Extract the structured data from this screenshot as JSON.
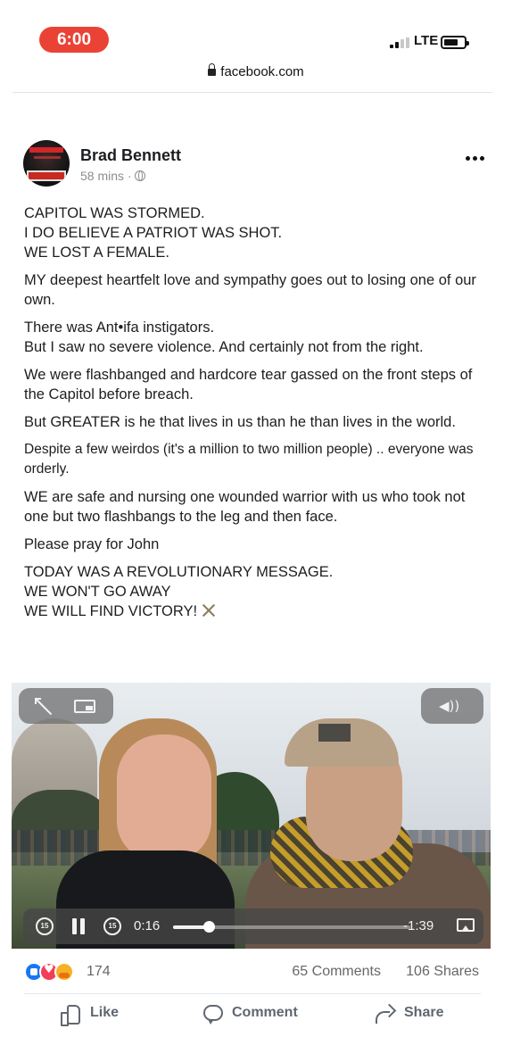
{
  "status_bar": {
    "time": "6:00",
    "network": "LTE",
    "signal_bars": 2,
    "battery_level": 0.55,
    "colors": {
      "time_pill": "#ea4335"
    }
  },
  "browser": {
    "url": "facebook.com",
    "icon": "lock-icon"
  },
  "post": {
    "author": "Brad Bennett",
    "time": "58 mins",
    "separator": " · ",
    "audience_icon": "globe-icon",
    "menu_icon": "more-icon",
    "paragraphs": [
      "CAPITOL WAS STORMED.\nI DO BELIEVE A PATRIOT WAS SHOT.\nWE LOST A FEMALE.",
      "MY deepest heartfelt love and sympathy goes out to losing one of our own.",
      "There was Ant•ifa instigators.\nBut I saw no severe violence. And certainly not from the right.",
      "We were flashbanged and hardcore tear gassed on the front steps of the Capitol before breach.",
      "But GREATER is he that lives in us than he than lives in the world.",
      "Despite a few weirdos (it's a million to two million people) .. everyone was orderly.",
      "WE are safe and nursing one wounded warrior with us who took not one but two flashbangs to the leg and then face.",
      "Please pray for John",
      "TODAY WAS A REVOLUTIONARY MESSAGE.\nWE WON'T GO AWAY\nWE WILL FIND VICTORY!"
    ]
  },
  "video": {
    "current_time": "0:16",
    "remaining_time": "-1:39",
    "progress": 0.15,
    "skip_back_label": "15",
    "skip_forward_label": "15",
    "icons": [
      "expand-icon",
      "pip-icon",
      "volume-icon",
      "skip-back-icon",
      "pause-icon",
      "skip-forward-icon",
      "airplay-icon"
    ]
  },
  "engagement": {
    "reaction_count": "174",
    "comments": "65 Comments",
    "shares": "106 Shares",
    "reaction_icons": [
      "like-reaction-icon",
      "love-reaction-icon",
      "care-reaction-icon"
    ]
  },
  "actions": {
    "like": "Like",
    "comment": "Comment",
    "share": "Share"
  },
  "colors": {
    "text": "#1c1e21",
    "secondary_text": "#65676b",
    "like_blue": "#1877f2",
    "love_red": "#f33e58"
  }
}
